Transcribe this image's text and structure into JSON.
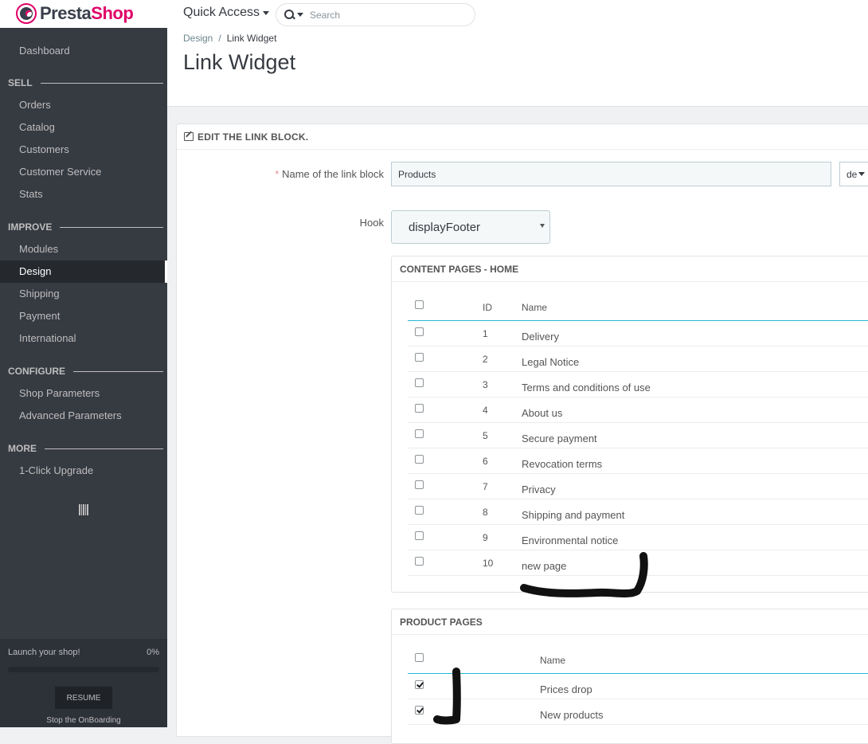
{
  "brand": {
    "presta": "Presta",
    "shop": "Shop"
  },
  "topbar": {
    "quick_access": "Quick Access",
    "search_placeholder": "Search"
  },
  "sidebar": {
    "dashboard": "Dashboard",
    "sections": [
      {
        "title": "SELL",
        "items": [
          "Orders",
          "Catalog",
          "Customers",
          "Customer Service",
          "Stats"
        ]
      },
      {
        "title": "IMPROVE",
        "items": [
          "Modules",
          "Design",
          "Shipping",
          "Payment",
          "International"
        ]
      },
      {
        "title": "CONFIGURE",
        "items": [
          "Shop Parameters",
          "Advanced Parameters"
        ]
      },
      {
        "title": "MORE",
        "items": [
          "1-Click Upgrade"
        ]
      }
    ],
    "active_item": "Design",
    "onboarding": {
      "launch": "Launch your shop!",
      "percent": "0%",
      "progress_fraction": 0,
      "resume": "RESUME",
      "stop": "Stop the OnBoarding"
    }
  },
  "page": {
    "breadcrumb_parent": "Design",
    "breadcrumb_sep": "/",
    "breadcrumb_current": "Link Widget",
    "title": "Link Widget"
  },
  "form": {
    "panel_title": "EDIT THE LINK BLOCK.",
    "name_required": "*",
    "name_label": "Name of the link block",
    "name_value": "Products",
    "lang": "de",
    "hook_label": "Hook",
    "hook_value": "displayFooter"
  },
  "content_pages": {
    "title": "CONTENT PAGES - HOME",
    "col_id": "ID",
    "col_name": "Name",
    "rows": [
      {
        "id": "1",
        "name": "Delivery"
      },
      {
        "id": "2",
        "name": "Legal Notice"
      },
      {
        "id": "3",
        "name": "Terms and conditions of use"
      },
      {
        "id": "4",
        "name": "About us"
      },
      {
        "id": "5",
        "name": "Secure payment"
      },
      {
        "id": "6",
        "name": "Revocation terms"
      },
      {
        "id": "7",
        "name": "Privacy"
      },
      {
        "id": "8",
        "name": "Shipping and payment"
      },
      {
        "id": "9",
        "name": "Environmental notice"
      },
      {
        "id": "10",
        "name": "new page"
      }
    ]
  },
  "product_pages": {
    "title": "PRODUCT PAGES",
    "col_name": "Name",
    "rows": [
      {
        "name": "Prices drop",
        "checked": true
      },
      {
        "name": "New products",
        "checked": true
      }
    ]
  }
}
